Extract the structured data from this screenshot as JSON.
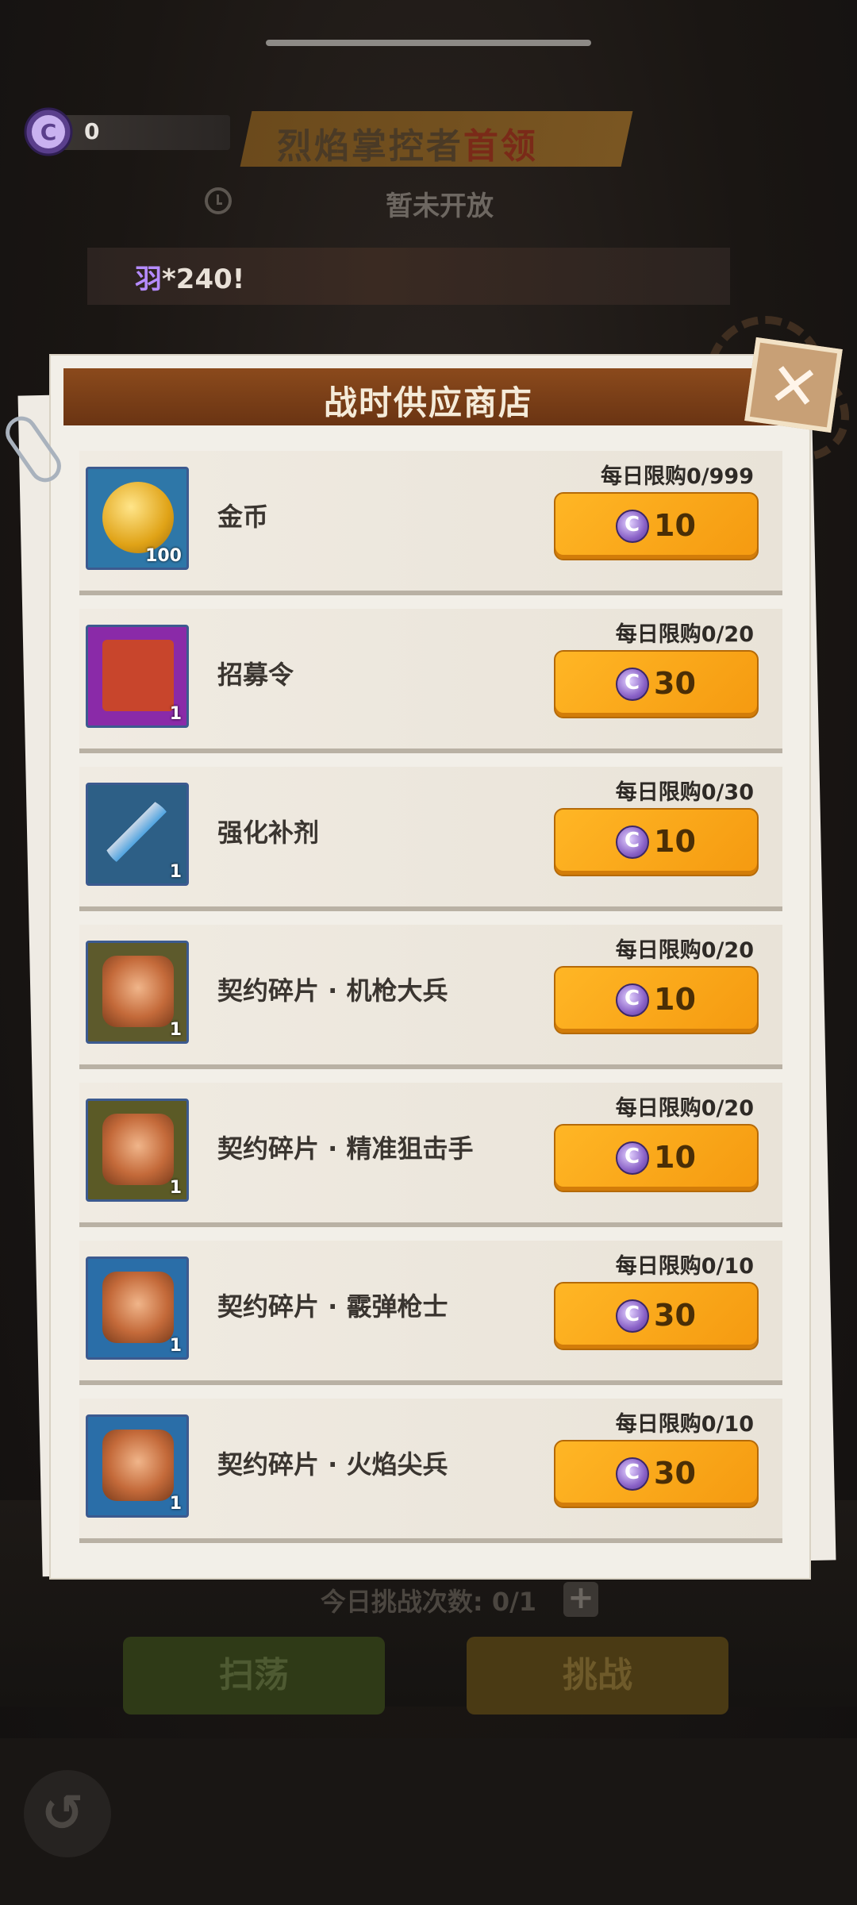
{
  "currency": {
    "icon": "ticket-coin-icon",
    "amount": "0"
  },
  "event": {
    "title_main": "烈焰掌控者",
    "title_accent": "首领",
    "status": "暂未开放",
    "marquee": "*240!",
    "marquee_accent": "羽"
  },
  "shop": {
    "title": "战时供应商店",
    "items": [
      {
        "name": "金币",
        "count": "100",
        "limit": "每日限购0/999",
        "price": "10",
        "icon": "gold-coin-icon",
        "bg": "#2e77a8"
      },
      {
        "name": "招募令",
        "count": "1",
        "limit": "每日限购0/20",
        "price": "30",
        "icon": "recruit-ticket-icon",
        "bg": "#8a2aa8"
      },
      {
        "name": "强化补剂",
        "count": "1",
        "limit": "每日限购0/30",
        "price": "10",
        "icon": "syringe-icon",
        "bg": "#2d5f86"
      },
      {
        "name": "契约碎片 · 机枪大兵",
        "count": "1",
        "limit": "每日限购0/20",
        "price": "10",
        "icon": "puzzle-soldier-icon",
        "bg": "#5d5a2c"
      },
      {
        "name": "契约碎片 · 精准狙击手",
        "count": "1",
        "limit": "每日限购0/20",
        "price": "10",
        "icon": "puzzle-sniper-icon",
        "bg": "#5b5a26"
      },
      {
        "name": "契约碎片 · 霰弹枪士",
        "count": "1",
        "limit": "每日限购0/10",
        "price": "30",
        "icon": "puzzle-shotgunner-icon",
        "bg": "#2a6ea8"
      },
      {
        "name": "契约碎片 · 火焰尖兵",
        "count": "1",
        "limit": "每日限购0/10",
        "price": "30",
        "icon": "puzzle-flamer-icon",
        "bg": "#2a6ea8"
      }
    ]
  },
  "bottom": {
    "challenge_label": "今日挑战次数: 0/1",
    "plus": "+",
    "sweep": "扫荡",
    "challenge": "挑战",
    "back": "↺"
  },
  "close": "✕"
}
